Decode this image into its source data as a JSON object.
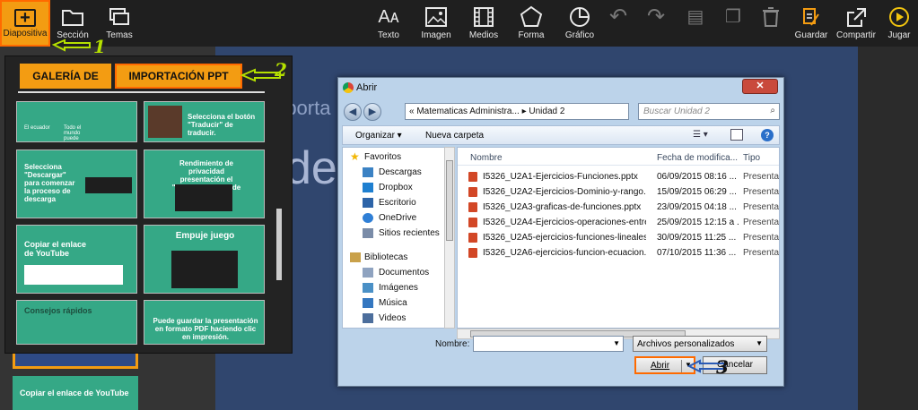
{
  "toolbar": {
    "left": [
      {
        "label": "Diapositiva",
        "icon": "plus-icon",
        "active": true
      },
      {
        "label": "Sección",
        "icon": "folder-icon"
      },
      {
        "label": "Temas",
        "icon": "layers-icon"
      }
    ],
    "right": [
      {
        "label": "Texto",
        "icon": "text-icon",
        "glyph": "Aᴀ"
      },
      {
        "label": "Imagen",
        "icon": "image-icon",
        "glyph": "🖼"
      },
      {
        "label": "Medios",
        "icon": "film-icon",
        "glyph": "▦"
      },
      {
        "label": "Forma",
        "icon": "pentagon-icon",
        "glyph": "⬠"
      },
      {
        "label": "Gráfico",
        "icon": "pie-chart-icon",
        "glyph": "◔"
      },
      {
        "label": "",
        "icon": "undo-icon",
        "glyph": "↶"
      },
      {
        "label": "",
        "icon": "redo-icon",
        "glyph": "↷"
      },
      {
        "label": "",
        "icon": "document-icon",
        "glyph": "▤"
      },
      {
        "label": "",
        "icon": "copy-icon",
        "glyph": "❐"
      },
      {
        "label": "",
        "icon": "trash-icon",
        "glyph": "🗑"
      },
      {
        "label": "Guardar",
        "icon": "save-icon",
        "glyph": "✎"
      },
      {
        "label": "Compartir",
        "icon": "share-icon",
        "glyph": "⇗"
      },
      {
        "label": "Jugar",
        "icon": "play-icon",
        "glyph": "▶"
      }
    ]
  },
  "gallery": {
    "tab_gallery": "GALERÍA DE",
    "tab_import": "IMPORTACIÓN PPT",
    "thumbs": [
      {
        "text": "Selecciona el botón \"Traducir\" de traducir."
      },
      {
        "text": "Selecciona \"Descargar\" para comenzar la proceso de descarga"
      },
      {
        "text": "Rendimiento de privacidad presentación el \"pública\" acceso de"
      },
      {
        "text": "Copiar el enlace de YouTube"
      },
      {
        "text": "Empuje juego"
      },
      {
        "text": "Consejos rápidos"
      },
      {
        "text": "Puede guardar la presentación en formato PDF haciendo clic en impresión."
      }
    ],
    "thumb_small_labels": [
      "El ecuador",
      "Todo el mundo puede hacerlo"
    ]
  },
  "canvas": {
    "text_line1": "mporta",
    "text_line2": "de"
  },
  "left_slides": {
    "slide2_label": "Copiar el enlace de YouTube"
  },
  "dialog": {
    "title": "Abrir",
    "address": "«  Matematicas Administra...  ▸  Unidad 2",
    "search_placeholder": "Buscar Unidad 2",
    "organize": "Organizar ▾",
    "new_folder": "Nueva carpeta",
    "nav": [
      {
        "label": "Favoritos",
        "icon": "star-icon",
        "color": "#f2b705"
      },
      {
        "label": "Descargas",
        "icon": "downloads-icon",
        "color": "#3b82c4"
      },
      {
        "label": "Dropbox",
        "icon": "dropbox-icon",
        "color": "#1e7fd0"
      },
      {
        "label": "Escritorio",
        "icon": "desktop-icon",
        "color": "#2d64a8"
      },
      {
        "label": "OneDrive",
        "icon": "onedrive-icon",
        "color": "#2f7fd6"
      },
      {
        "label": "Sitios recientes",
        "icon": "recent-icon",
        "color": "#7a8ca8"
      },
      {
        "label": "Bibliotecas",
        "icon": "libraries-icon",
        "color": "#c9a14a"
      },
      {
        "label": "Documentos",
        "icon": "documents-icon",
        "color": "#8fa3c0"
      },
      {
        "label": "Imágenes",
        "icon": "pictures-icon",
        "color": "#4a90c6"
      },
      {
        "label": "Música",
        "icon": "music-icon",
        "color": "#3477c0"
      },
      {
        "label": "Videos",
        "icon": "videos-icon",
        "color": "#4c6e9c"
      }
    ],
    "columns": {
      "name": "Nombre",
      "date": "Fecha de modifica...",
      "type": "Tipo"
    },
    "files": [
      {
        "name": "I5326_U2A1-Ejercicios-Funciones.pptx",
        "date": "06/09/2015 08:16 ...",
        "type": "Presentac"
      },
      {
        "name": "I5326_U2A2-Ejercicios-Dominio-y-rango...",
        "date": "15/09/2015 06:29 ...",
        "type": "Presentac"
      },
      {
        "name": "I5326_U2A3-graficas-de-funciones.pptx",
        "date": "23/09/2015 04:18 ...",
        "type": "Presentac"
      },
      {
        "name": "I5326_U2A4-Ejercicios-operaciones-entre...",
        "date": "25/09/2015 12:15 a ...",
        "type": "Presentac"
      },
      {
        "name": "I5326_U2A5-ejercicios-funciones-lineales...",
        "date": "30/09/2015 11:25 ...",
        "type": "Presentac"
      },
      {
        "name": "I5326_U2A6-ejercicios-funcion-ecuacion...",
        "date": "07/10/2015 11:36 ...",
        "type": "Presentac"
      }
    ],
    "filename_label": "Nombre:",
    "filename_value": "",
    "filetype": "Archivos personalizados",
    "open_label": "Abrir",
    "cancel_label": "Cancelar"
  },
  "annotations": {
    "n1": "1",
    "n2": "2",
    "n3": "3",
    "color": "#b5e000"
  }
}
